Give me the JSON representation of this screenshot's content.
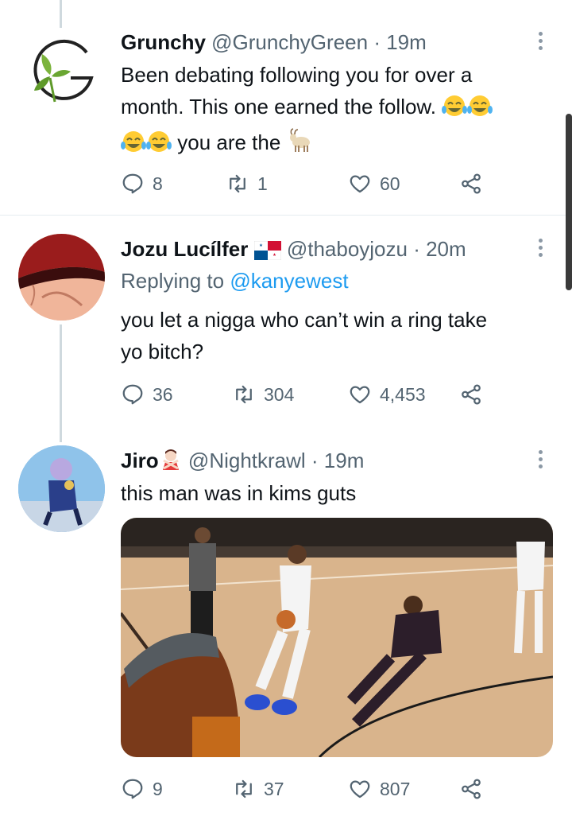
{
  "tweets": [
    {
      "name": "Grunchy",
      "flag": "",
      "handle": "@GrunchyGreen",
      "time": "· 19m",
      "reply_prefix": "",
      "reply_to": "",
      "text_line1": "Been debating following you for over a",
      "text_line2": "month. This one earned the follow.",
      "text_line3": "you are the",
      "replies": "8",
      "retweets": "1",
      "likes": "60",
      "avatar_icon": "grunchy-leaf-logo"
    },
    {
      "name": "Jozu Lucílfer",
      "flag": "panama-flag-icon",
      "handle": "@thaboyjozu",
      "time": "· 20m",
      "reply_prefix": "Replying to",
      "reply_to": "@kanyewest",
      "text_line1": "you let a nigga who can’t win a ring take",
      "text_line2": "yo bitch?",
      "replies": "36",
      "retweets": "304",
      "likes": "4,453",
      "avatar_icon": "red-cap-avatar"
    },
    {
      "name": "Jiro",
      "flag": "person-gesturing-no-emoji",
      "handle": "@Nightkrawl",
      "time": "· 19m",
      "text_line1": "this man was in kims guts",
      "replies": "9",
      "retweets": "37",
      "likes": "807",
      "avatar_icon": "anime-character-avatar",
      "media": "basketball-game-video"
    }
  ],
  "colors": {
    "text": "#0f1419",
    "muted": "#536471",
    "link": "#1d9bf0",
    "line": "#cfd9de"
  }
}
